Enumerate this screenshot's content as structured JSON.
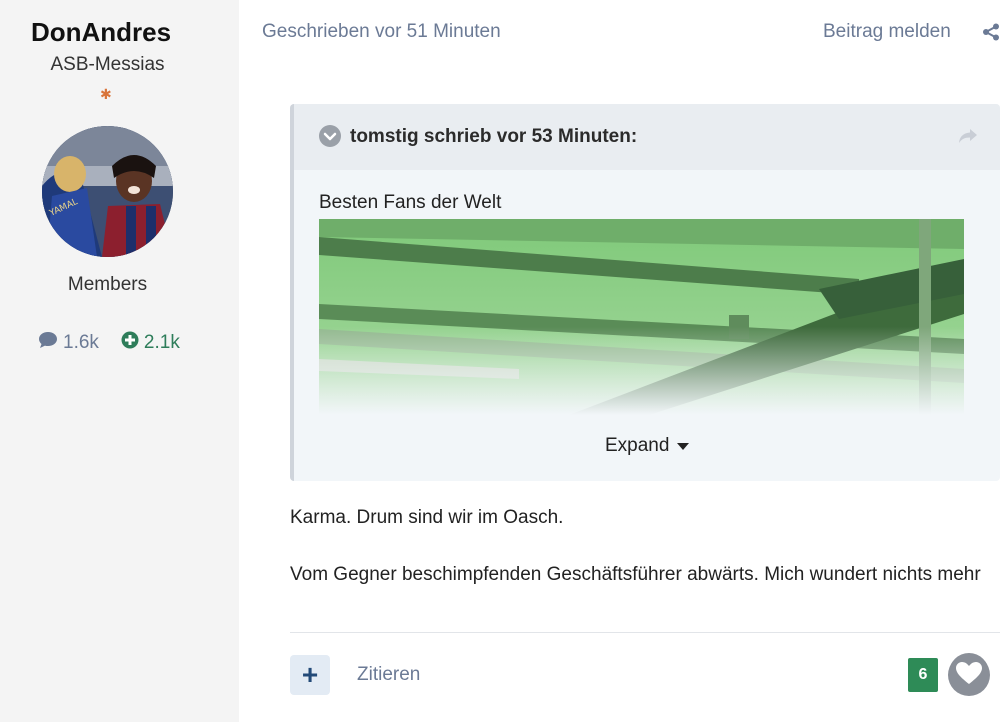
{
  "author": {
    "name": "DonAndres",
    "rank_title": "ASB-Messias",
    "group": "Members",
    "posts_count": "1.6k",
    "reputation": "2.1k"
  },
  "post": {
    "time_label": "Geschrieben vor 51 Minuten",
    "report_label": "Beitrag melden",
    "quote": {
      "citation": "tomstig schrieb vor 53 Minuten:",
      "text": "Besten Fans der Welt",
      "expand_label": "Expand"
    },
    "paragraphs": [
      "Karma. Drum sind wir im Oasch.",
      "Vom Gegner beschimpfenden Geschäftsführer abwärts. Mich wundert nichts mehr"
    ],
    "quote_button_label": "Zitieren",
    "multiquote_label": "+",
    "reaction_count": "6"
  },
  "colors": {
    "sidebar_bg": "#f4f4f4",
    "muted_text": "#6b7a95",
    "rep_green": "#2e8b57",
    "quote_bg": "#f2f6f9",
    "quote_header_bg": "#e9edf1"
  },
  "icons": {
    "share": "share-icon",
    "comment": "comment-icon",
    "reputation": "plus-circle-icon",
    "collapse": "chevron-down-circle-icon",
    "quote_share": "share-arrow-icon",
    "expand": "caret-down-icon",
    "like": "heart-icon",
    "rank": "star-icon"
  }
}
